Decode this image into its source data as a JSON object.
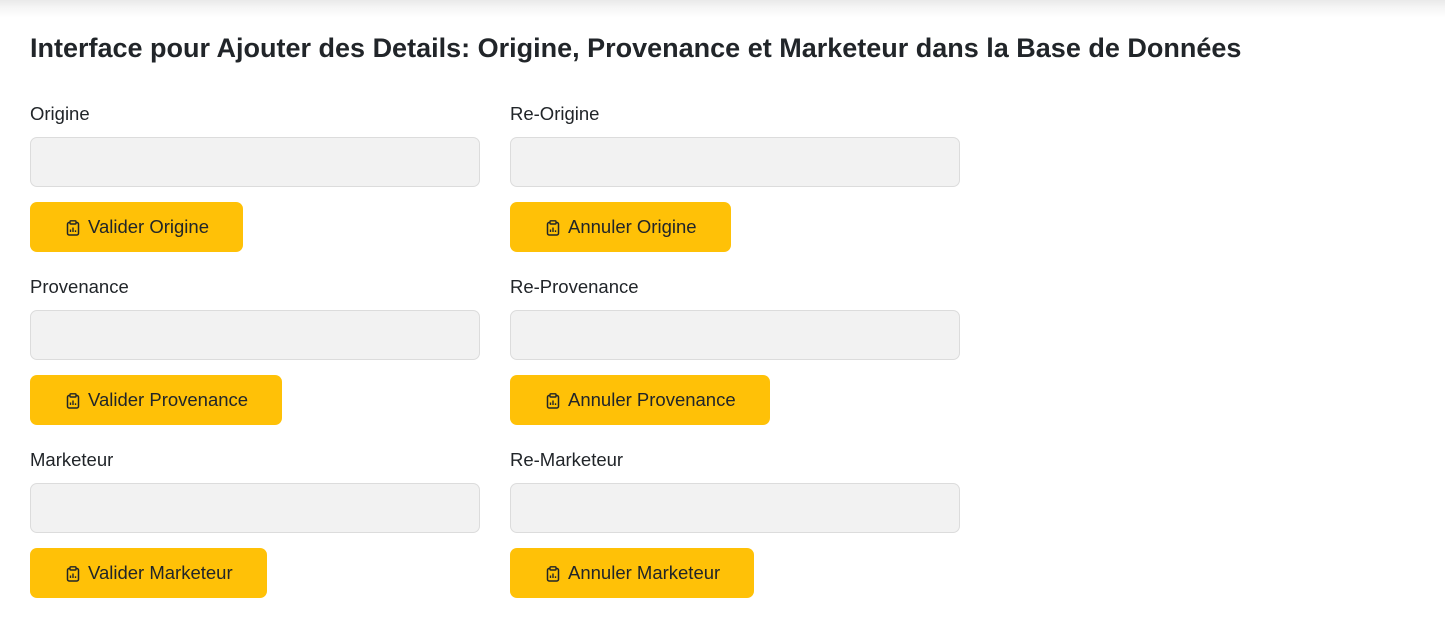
{
  "page": {
    "title": "Interface pour Ajouter des Details: Origine, Provenance et Marketeur dans la Base de Données"
  },
  "colors": {
    "button_bg": "#ffc107",
    "input_bg": "#f2f2f2",
    "text": "#212529"
  },
  "origine": {
    "label": "Origine",
    "value": "",
    "validate_label": "Valider Origine",
    "re_label": "Re-Origine",
    "re_value": "",
    "cancel_label": "Annuler Origine",
    "icon": "clipboard-data-icon"
  },
  "provenance": {
    "label": "Provenance",
    "value": "",
    "validate_label": "Valider Provenance",
    "re_label": "Re-Provenance",
    "re_value": "",
    "cancel_label": "Annuler Provenance",
    "icon": "clipboard-data-icon"
  },
  "marketeur": {
    "label": "Marketeur",
    "value": "",
    "validate_label": "Valider Marketeur",
    "re_label": "Re-Marketeur",
    "re_value": "",
    "cancel_label": "Annuler Marketeur",
    "icon": "clipboard-data-icon"
  }
}
